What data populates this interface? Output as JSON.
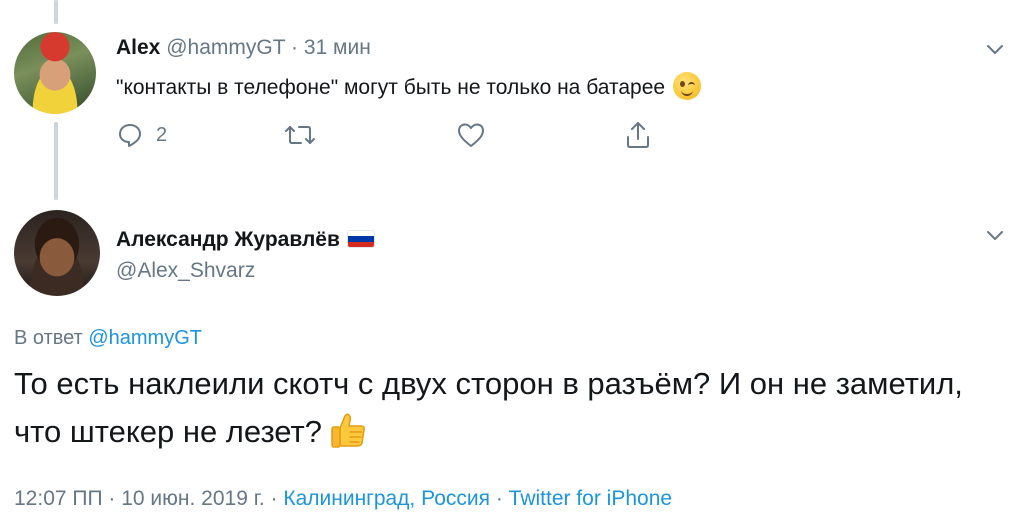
{
  "tweet1": {
    "name": "Alex",
    "handle": "@hammyGT",
    "separator": "·",
    "time": "31 мин",
    "text": "\"контакты в телефоне\" могут быть не только на батарее",
    "emoji": "winking-face",
    "actions": {
      "reply_count": "2"
    }
  },
  "tweet2": {
    "name": "Александр Журавлёв",
    "flag": "russia-flag",
    "handle": "@Alex_Shvarz",
    "reply_prefix": "В ответ",
    "reply_to": "@hammyGT",
    "text": "То есть наклеили скотч с двух сторон в разъём? И он не заметил, что штекер не лезет?",
    "emoji": "thumbs-up",
    "meta": {
      "datetime": "12:07 ПП · 10 июн. 2019 г.",
      "sep1": " · ",
      "location": "Калининград, Россия",
      "sep2": " · ",
      "source": "Twitter for iPhone"
    }
  },
  "colors": {
    "text": "#14171a",
    "muted": "#657786",
    "link": "#1b95e0",
    "thread_line": "#ccd6dd"
  }
}
